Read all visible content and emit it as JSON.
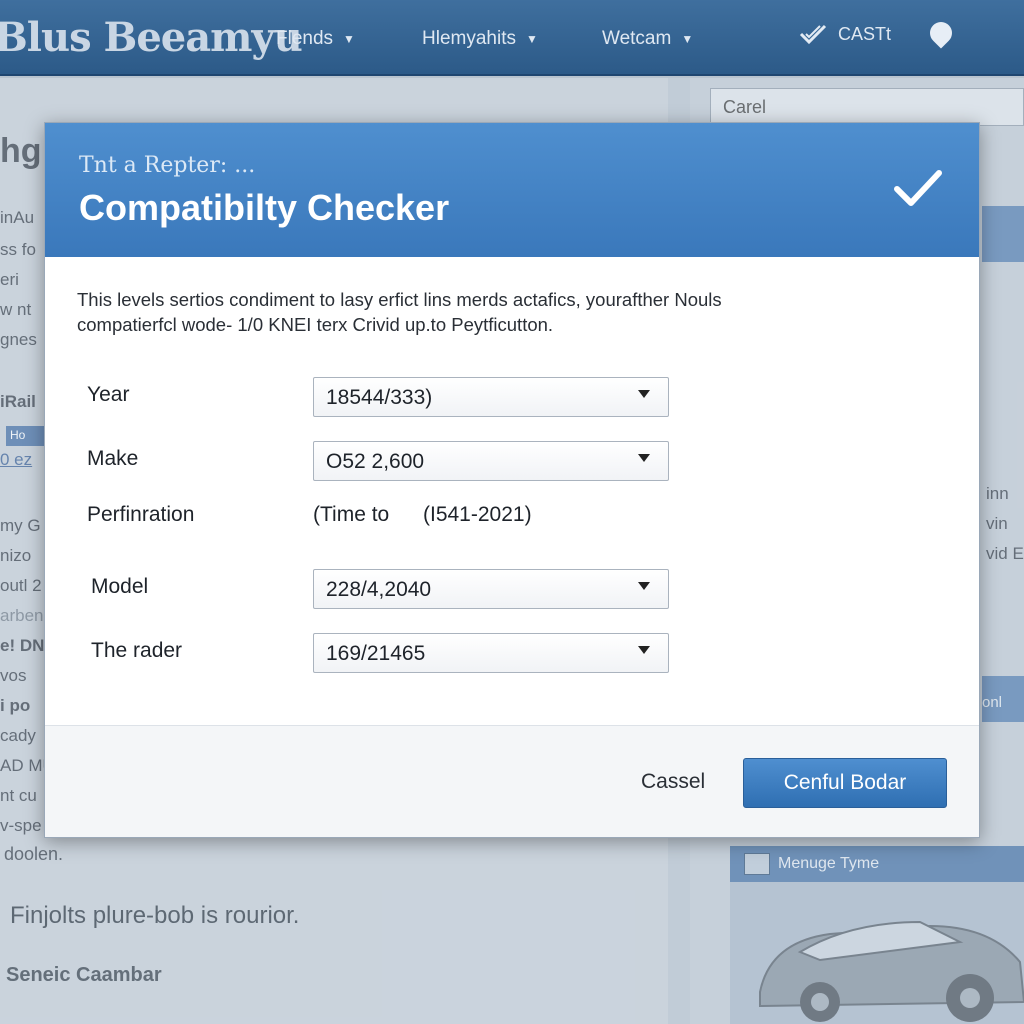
{
  "nav": {
    "logo": "Blus Beeamyu",
    "items": [
      {
        "label": "Flends"
      },
      {
        "label": "Hlemyahits"
      },
      {
        "label": "Wetcam"
      }
    ],
    "cast_label": "CASTt",
    "icons": {
      "caret": "caret-down-icon",
      "cast": "checkmark-cast-icon",
      "pin": "location-pin-icon"
    }
  },
  "background": {
    "search_value": "Carel",
    "left_snippets": [
      "hg",
      "inAu",
      "ss fo",
      "eri",
      "w nt",
      "gnes",
      "iRail",
      "Ho",
      "0 ez",
      "my G",
      "nizo",
      "outl 2",
      "arben",
      "e! DN",
      "vos",
      "i po",
      "cady",
      "AD MU",
      "nt cu",
      "v-spe"
    ],
    "right_snippets": [
      "inn",
      "vin",
      "vid E",
      "onl"
    ],
    "dooden": "doolen.",
    "bottom_big": "Finjolts plure-bob is rourior.",
    "bottom_small": "Seneic Caambar",
    "promo_title": "Menuge Tyme"
  },
  "dialog": {
    "subtitle": "Tnt a Repter: ...",
    "title": "Compatibilty Checker",
    "description_line1": "This levels sertios condiment to lasy erfict lins merds actafics, yourafther Nouls",
    "description_line2": "compatierfcl wode- 1/0 KNEI terx Crivid up.to Peytficutton.",
    "fields": {
      "year": {
        "label": "Year",
        "value": "18544/333)"
      },
      "make": {
        "label": "Make",
        "value": "O52 2,600"
      },
      "performance": {
        "label": "Perfinration",
        "value_a": "(Time to",
        "value_b": "(I541-2021)"
      },
      "model": {
        "label": "Model",
        "value": "228/4,2040"
      },
      "trader": {
        "label": "The rader",
        "value": "169/21465"
      }
    },
    "cancel_label": "Cassel",
    "primary_label": "Cenful Bodar",
    "colors": {
      "header": "#3f7fc2",
      "primary_button": "#3a7bc0"
    }
  }
}
